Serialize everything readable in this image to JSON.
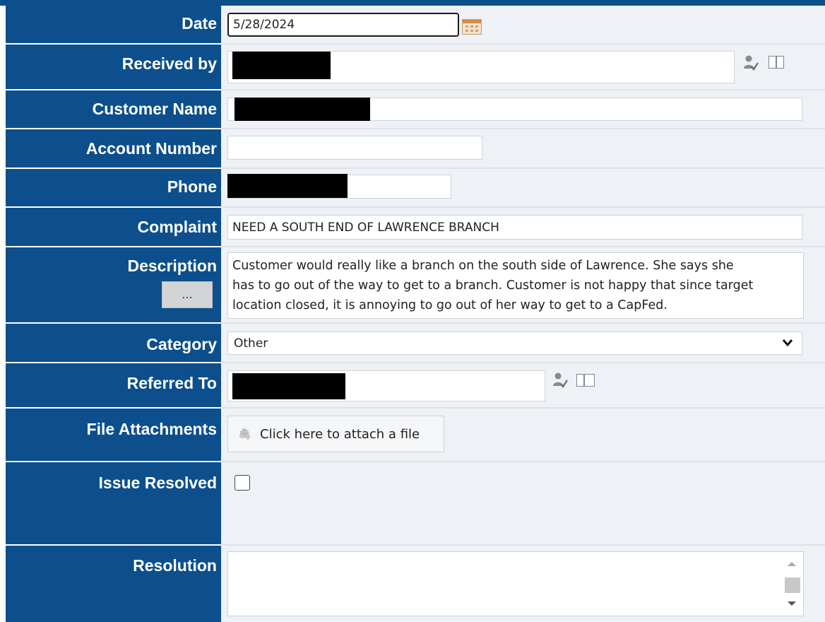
{
  "form": {
    "date": {
      "label": "Date",
      "value": "5/28/2024"
    },
    "received_by": {
      "label": "Received by",
      "value": ""
    },
    "customer_name": {
      "label": "Customer Name",
      "value": ""
    },
    "account_number": {
      "label": "Account Number",
      "value": ""
    },
    "phone": {
      "label": "Phone",
      "value": ""
    },
    "complaint": {
      "label": "Complaint",
      "value": "NEED A SOUTH END OF LAWRENCE BRANCH"
    },
    "description": {
      "label": "Description",
      "button_label": "...",
      "lines": [
        "Customer would really like a branch on the south side of Lawrence. She says she",
        "has to go out of the way to get to a branch. Customer is not happy that since target",
        "location closed, it is annoying to go out of her way to get to a CapFed."
      ]
    },
    "category": {
      "label": "Category",
      "value": "Other"
    },
    "referred_to": {
      "label": "Referred To",
      "value": ""
    },
    "file_attachments": {
      "label": "File Attachments",
      "button_label": "Click here to attach a file"
    },
    "issue_resolved": {
      "label": "Issue Resolved",
      "checked": false
    },
    "resolution": {
      "label": "Resolution",
      "value": ""
    }
  },
  "icons": {
    "calendar": "calendar-icon",
    "user_picker": "user-picker-icon",
    "address_book": "address-book-icon",
    "paperclip": "paperclip-icon",
    "dropdown": "chevron-down-icon"
  },
  "colors": {
    "label_bg": "#0d4f8c",
    "field_bg": "#eef1f5"
  }
}
